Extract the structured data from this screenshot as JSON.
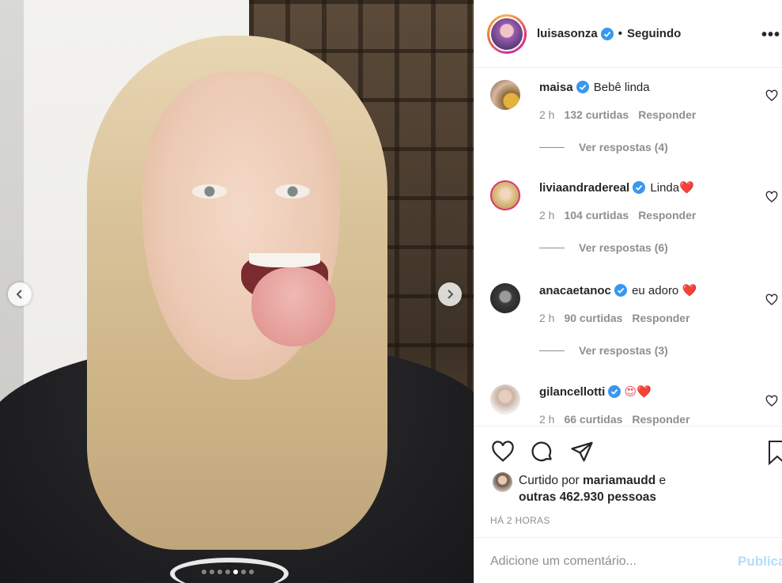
{
  "header": {
    "username": "luisasonza",
    "separator": "•",
    "follow_status": "Seguindo",
    "more": "•••"
  },
  "comments": [
    {
      "user": "maisa",
      "text": "Bebê linda",
      "time": "2 h",
      "likes": "132 curtidas",
      "reply": "Responder",
      "view_replies": "Ver respostas (4)"
    },
    {
      "user": "liviaandradereal",
      "text": "Linda",
      "emoji": "❤️",
      "time": "2 h",
      "likes": "104 curtidas",
      "reply": "Responder",
      "view_replies": "Ver respostas (6)"
    },
    {
      "user": "anacaetanoc",
      "text": "eu adoro",
      "emoji": "❤️",
      "time": "2 h",
      "likes": "90 curtidas",
      "reply": "Responder",
      "view_replies": "Ver respostas (3)"
    },
    {
      "user": "gilancellotti",
      "text": "",
      "emoji": "😍❤️",
      "time": "2 h",
      "likes": "66 curtidas",
      "reply": "Responder"
    }
  ],
  "likes": {
    "prefix": "Curtido por",
    "user": "mariamaudd",
    "and": "e",
    "others": "outras 462.930 pessoas"
  },
  "time_ago": "HÁ 2 HORAS",
  "add_comment": {
    "placeholder": "Adicione um comentário...",
    "publish": "Publicar"
  },
  "carousel": {
    "total": 7,
    "active_index": 4
  },
  "colors": {
    "verified": "#3897f0",
    "heart_red": "#ed4956",
    "publish_disabled": "#b2dffc",
    "muted": "#8e8e8e"
  }
}
